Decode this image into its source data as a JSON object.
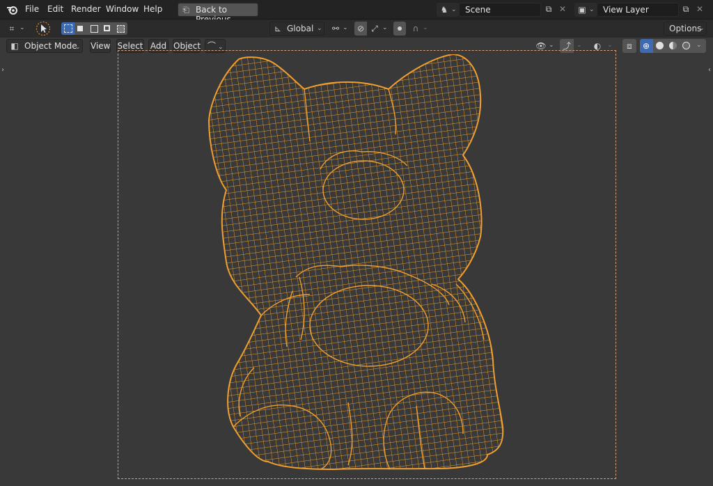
{
  "topbar": {
    "menu": [
      "File",
      "Edit",
      "Render",
      "Window",
      "Help"
    ],
    "back_button": "Back to Previous",
    "scene": "Scene",
    "view_layer": "View Layer"
  },
  "toolbar": {
    "orientation": "Global",
    "options": "Options"
  },
  "header": {
    "mode": "Object Mode",
    "view": "View",
    "select": "Select",
    "add": "Add",
    "object": "Object"
  },
  "colors": {
    "wire": "#f0a030",
    "background": "#393939",
    "topbar": "#232323",
    "active_button": "#3d6ab0"
  },
  "icons": {
    "blender_logo": "blender-icon",
    "back": "back-icon",
    "scene": "scene-icon",
    "view_layer": "view-layer-icon",
    "new": "duplicate-icon",
    "close": "close-icon",
    "editor_type": "editor-type-icon",
    "select_tool": "cursor-icon",
    "transform_pivot": "pivot-icon",
    "snap": "snap-icon",
    "proportional": "proportional-icon",
    "visibility": "eye-icon",
    "gizmo": "gizmo-icon",
    "overlay": "overlay-icon",
    "xray": "xray-icon",
    "shading_wire": "wireframe-icon",
    "shading_solid": "solid-icon",
    "shading_material": "material-icon",
    "shading_render": "render-icon"
  }
}
